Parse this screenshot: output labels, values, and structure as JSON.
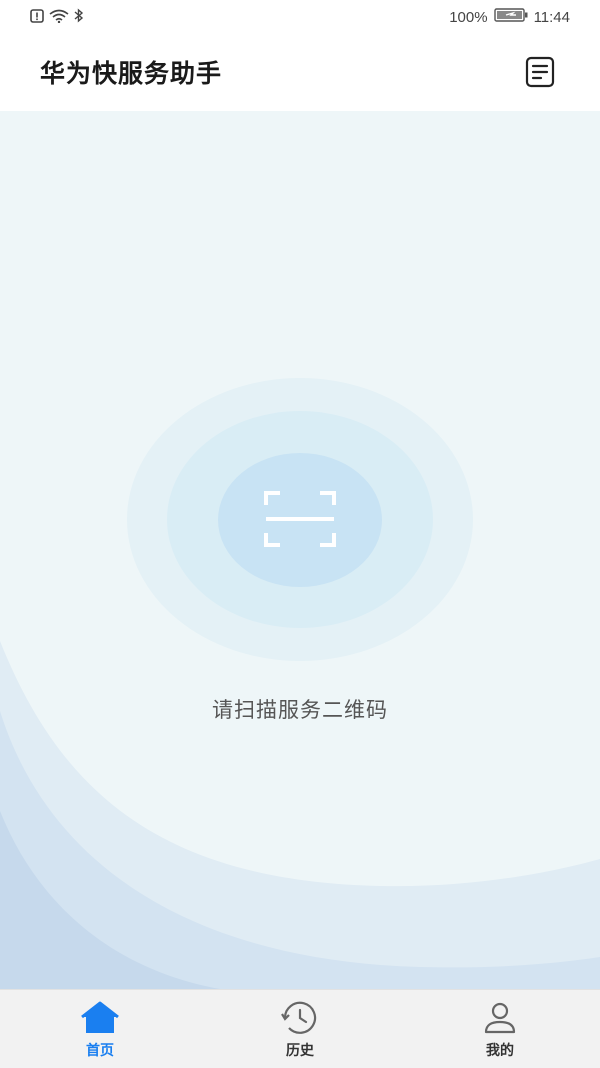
{
  "status_bar": {
    "battery_percent": "100%",
    "time": "11:44",
    "icons": [
      "sim-alert-icon",
      "wifi-icon",
      "bluetooth-icon",
      "battery-charging-icon"
    ]
  },
  "header": {
    "title": "华为快服务助手",
    "doc_icon": "document-list-icon"
  },
  "main": {
    "scan_icon": "scan-frame-icon",
    "scan_hint": "请扫描服务二维码"
  },
  "tabs": [
    {
      "label": "首页",
      "icon": "home-icon",
      "active": true
    },
    {
      "label": "历史",
      "icon": "history-clock-icon",
      "active": false
    },
    {
      "label": "我的",
      "icon": "user-profile-icon",
      "active": false
    }
  ],
  "colors": {
    "accent": "#1a7ff0",
    "background": "#eef6f8",
    "scan_circle": "#c8e3f4"
  }
}
